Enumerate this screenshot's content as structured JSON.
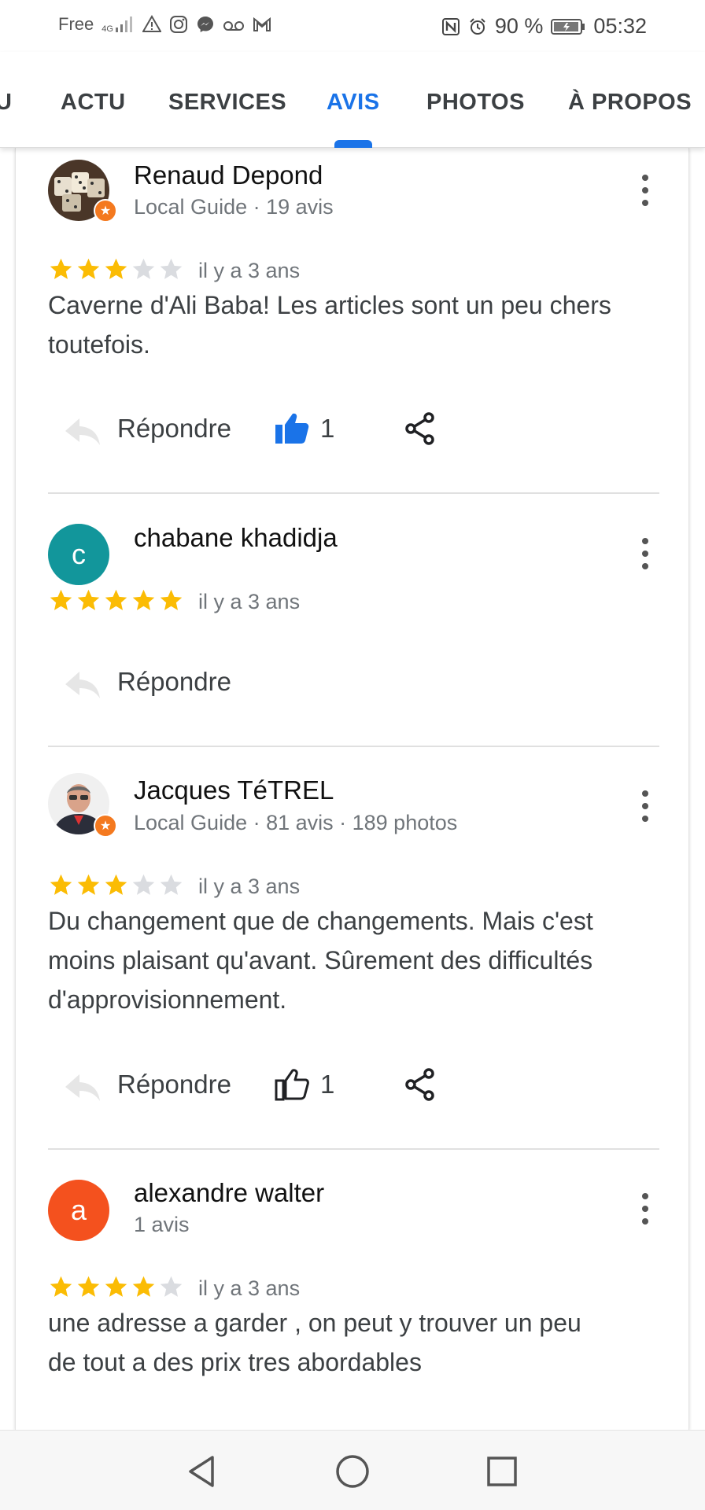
{
  "status_bar": {
    "carrier": "Free",
    "network": "4G",
    "battery": "90 %",
    "time": "05:32"
  },
  "tabs": [
    {
      "label": "U"
    },
    {
      "label": "ACTU"
    },
    {
      "label": "SERVICES"
    },
    {
      "label": "AVIS",
      "active": true
    },
    {
      "label": "PHOTOS"
    },
    {
      "label": "À PROPOS"
    }
  ],
  "reviews": [
    {
      "author": "Renaud Depond",
      "meta": "Local Guide · 19 avis",
      "avatar_letter": "",
      "local_guide": true,
      "rating": 3,
      "time": "il y a 3 ans",
      "text": "Caverne d'Ali Baba! Les articles sont un peu chers toutefois.",
      "reply_label": "Répondre",
      "likes": "1",
      "liked": true
    },
    {
      "author": "chabane khadidja",
      "meta": "",
      "avatar_letter": "c",
      "avatar_color": "#12969b",
      "local_guide": false,
      "rating": 5,
      "time": "il y a 3 ans",
      "text": "",
      "reply_label": "Répondre"
    },
    {
      "author": "Jacques TéTREL",
      "meta": "Local Guide · 81 avis · 189 photos",
      "avatar_letter": "",
      "local_guide": true,
      "rating": 3,
      "time": "il y a 3 ans",
      "text": "Du changement que de changements. Mais c'est moins plaisant qu'avant. Sûrement des difficultés d'approvisionnement.",
      "reply_label": "Répondre",
      "likes": "1",
      "liked": false
    },
    {
      "author": "alexandre walter",
      "meta": "1 avis",
      "avatar_letter": "a",
      "avatar_color": "#f4511e",
      "local_guide": false,
      "rating": 4,
      "time": "il y a 3 ans",
      "text": "une adresse a garder , on peut y trouver un peu de tout a des prix tres abordables"
    }
  ],
  "colors": {
    "accent": "#1a73e8",
    "star": "#fbbc04",
    "star_empty": "#dadce0",
    "local_guide_badge": "#f4791f"
  },
  "icons": {
    "reply": "reply-arrow-icon",
    "like": "thumbs-up-icon",
    "share": "share-icon",
    "menu": "more-vert-icon",
    "nav_back": "triangle-back-icon",
    "nav_home": "circle-home-icon",
    "nav_recents": "square-recents-icon"
  }
}
